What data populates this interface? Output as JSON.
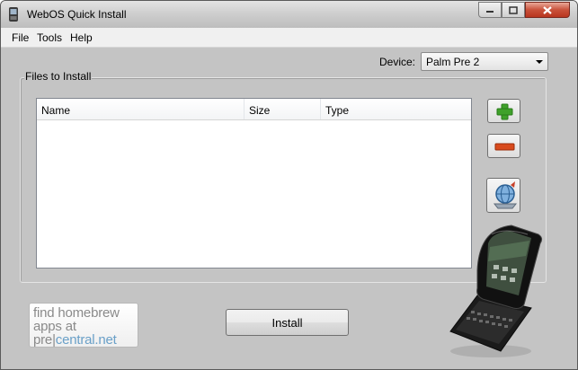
{
  "window": {
    "title": "WebOS Quick Install",
    "icons": {
      "app": "palm-phone-icon",
      "minimize": "minimize-icon",
      "maximize": "maximize-icon",
      "close": "close-icon"
    }
  },
  "menu": {
    "items": [
      {
        "label": "File"
      },
      {
        "label": "Tools"
      },
      {
        "label": "Help"
      }
    ]
  },
  "device": {
    "label": "Device:",
    "selected": "Palm Pre 2"
  },
  "files_group": {
    "title": "Files to Install",
    "columns": [
      {
        "label": "Name"
      },
      {
        "label": "Size"
      },
      {
        "label": "Type"
      }
    ],
    "rows": []
  },
  "side_buttons": [
    {
      "icon": "add-icon"
    },
    {
      "icon": "remove-icon"
    },
    {
      "icon": "globe-icon"
    }
  ],
  "promo": {
    "line1": "find homebrew",
    "line2": "apps at",
    "line3_a": "pre",
    "line3_sep": "|",
    "line3_b": "central.net"
  },
  "install_button": {
    "label": "Install"
  },
  "colors": {
    "accent_green": "#3fa12a",
    "accent_red": "#d84a1c",
    "promo_blue": "#6aa0c8",
    "window_bg": "#c4c4c4"
  }
}
